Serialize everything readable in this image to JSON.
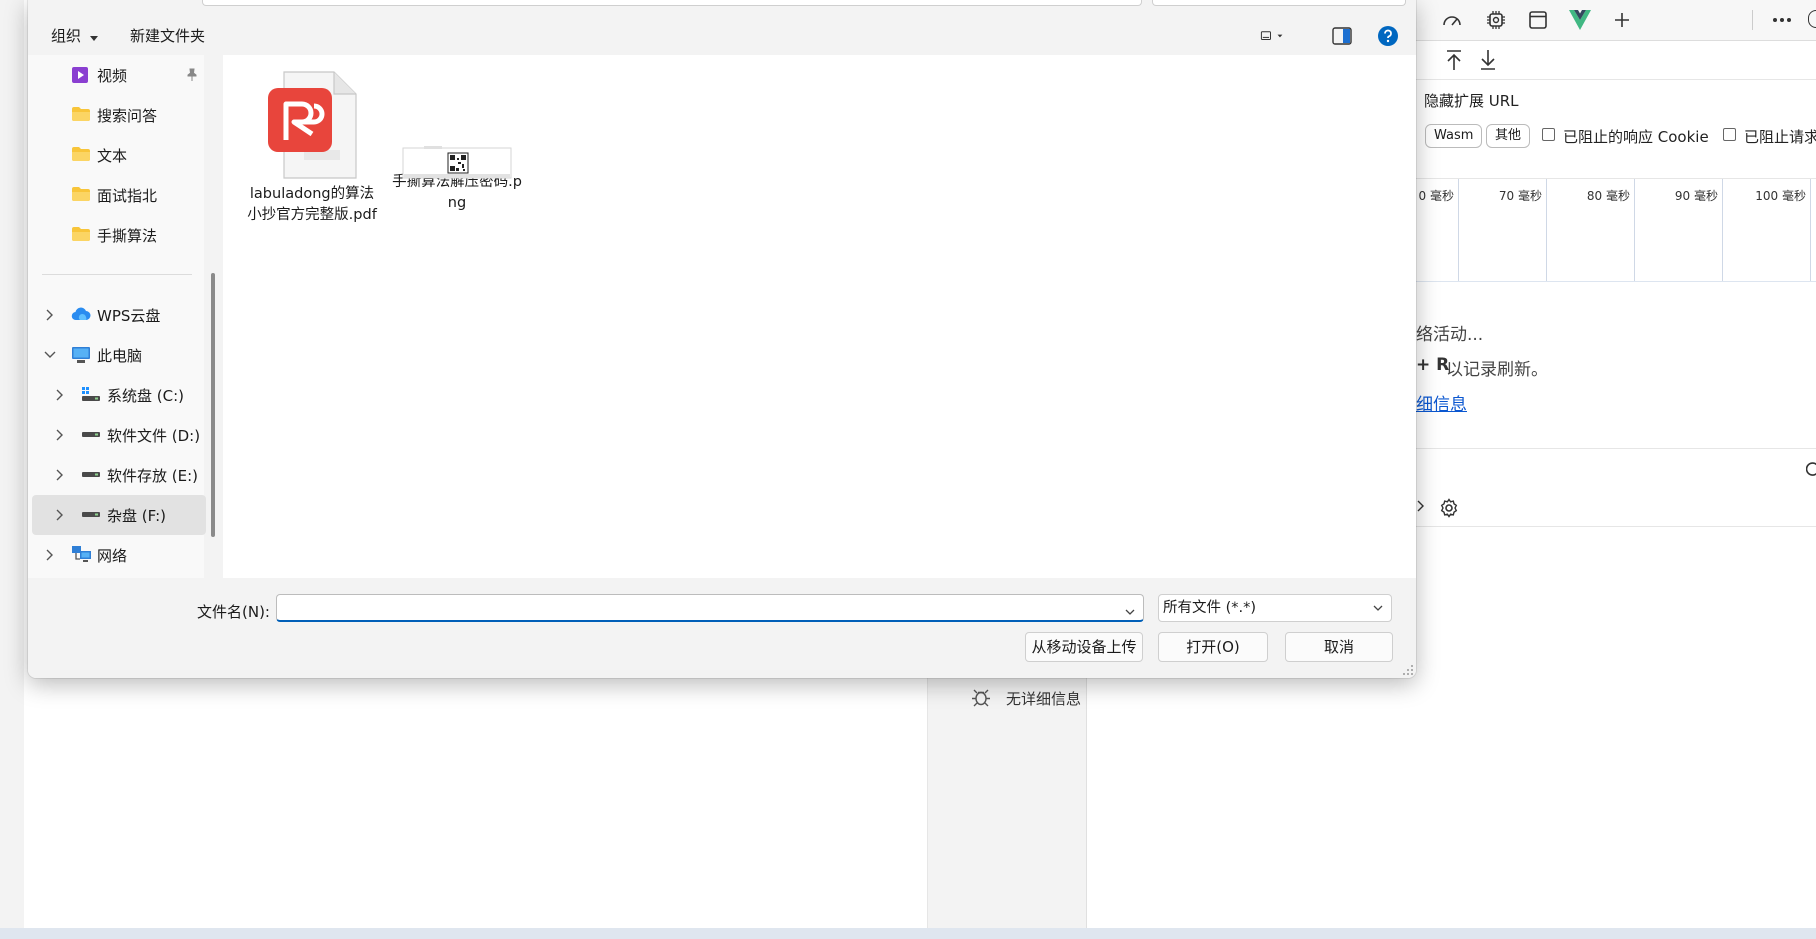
{
  "dialog": {
    "toolbar": {
      "organize_label": "组织",
      "new_folder_label": "新建文件夹"
    },
    "nav": {
      "items": [
        {
          "label": "视频",
          "icon": "video-icon"
        },
        {
          "label": "搜索问答",
          "icon": "folder-icon"
        },
        {
          "label": "文本",
          "icon": "folder-icon"
        },
        {
          "label": "面试指北",
          "icon": "folder-icon"
        },
        {
          "label": "手撕算法",
          "icon": "folder-icon"
        },
        {
          "label": "WPS云盘",
          "icon": "cloud-icon"
        },
        {
          "label": "此电脑",
          "icon": "pc-icon"
        },
        {
          "label": "系统盘 (C:)",
          "icon": "drive-icon"
        },
        {
          "label": "软件文件 (D:)",
          "icon": "drive-icon"
        },
        {
          "label": "软件存放 (E:)",
          "icon": "drive-icon"
        },
        {
          "label": "杂盘 (F:)",
          "icon": "drive-icon"
        },
        {
          "label": "网络",
          "icon": "network-icon"
        }
      ]
    },
    "files": [
      {
        "name": "labuladong的算法小抄官方完整版.pdf",
        "icon": "wps-pdf-icon"
      },
      {
        "name": "手撕算法解压密码.png",
        "icon": "image-thumbnail-icon"
      }
    ],
    "footer": {
      "filename_label": "文件名(N):",
      "filename_value": "",
      "filetype_value": "所有文件 (*.*)",
      "upload_label": "从移动设备上传",
      "open_label": "打开(O)",
      "cancel_label": "取消"
    }
  },
  "background": {
    "devtools": {
      "hide_ext_url": "隐藏扩展 URL",
      "filter_chips": [
        "Wasm",
        "其他"
      ],
      "blocked_cookie_label": "已阻止的响应 Cookie",
      "blocked_request_label": "已阻止请求",
      "timeline_ticks": [
        "0 毫秒",
        "70 毫秒",
        "80 毫秒",
        "90 毫秒",
        "100 毫秒"
      ],
      "message_line1": "络活动...",
      "message_line2_bold": "+ R",
      "message_line2": "以记录刷新。",
      "message_link": "细信息",
      "no_details_label": "无详细信息"
    },
    "colors": {
      "accent": "#005fb8",
      "help": "#0067c0",
      "vue_green": "#41b883",
      "vue_dark": "#34495e",
      "wps_red": "#e8453c",
      "folder": "#f8c53a"
    }
  }
}
